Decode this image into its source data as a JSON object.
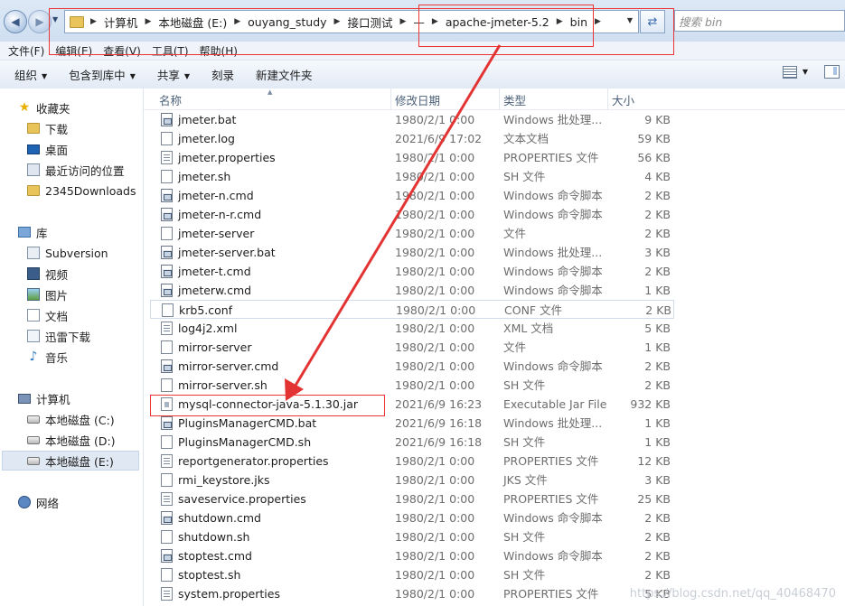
{
  "address": {
    "crumbs": [
      "计算机",
      "本地磁盘 (E:)",
      "ouyang_study",
      "接口测试",
      "—",
      "apache-jmeter-5.2",
      "bin"
    ],
    "search_placeholder": "搜索 bin"
  },
  "menu": [
    "文件(F)",
    "编辑(E)",
    "查看(V)",
    "工具(T)",
    "帮助(H)"
  ],
  "commands": [
    {
      "label": "组织",
      "dropdown": true
    },
    {
      "label": "包含到库中",
      "dropdown": true
    },
    {
      "label": "共享",
      "dropdown": true
    },
    {
      "label": "刻录",
      "dropdown": false
    },
    {
      "label": "新建文件夹",
      "dropdown": false
    }
  ],
  "nav": {
    "favorites": {
      "label": "收藏夹",
      "items": [
        "下载",
        "桌面",
        "最近访问的位置",
        "2345Downloads"
      ]
    },
    "libraries": {
      "label": "库",
      "items": [
        "Subversion",
        "视频",
        "图片",
        "文档",
        "迅雷下载",
        "音乐"
      ]
    },
    "computer": {
      "label": "计算机",
      "items": [
        "本地磁盘 (C:)",
        "本地磁盘 (D:)",
        "本地磁盘 (E:)"
      ]
    },
    "network": {
      "label": "网络"
    }
  },
  "columns": {
    "name": "名称",
    "date": "修改日期",
    "type": "类型",
    "size": "大小"
  },
  "files": [
    {
      "name": "jmeter.bat",
      "date": "1980/2/1 0:00",
      "type": "Windows 批处理...",
      "size": "9 KB",
      "icon": "bat"
    },
    {
      "name": "jmeter.log",
      "date": "2021/6/9 17:02",
      "type": "文本文档",
      "size": "59 KB",
      "icon": "txt"
    },
    {
      "name": "jmeter.properties",
      "date": "1980/2/1 0:00",
      "type": "PROPERTIES 文件",
      "size": "56 KB",
      "icon": "prop"
    },
    {
      "name": "jmeter.sh",
      "date": "1980/2/1 0:00",
      "type": "SH 文件",
      "size": "4 KB",
      "icon": "txt"
    },
    {
      "name": "jmeter-n.cmd",
      "date": "1980/2/1 0:00",
      "type": "Windows 命令脚本",
      "size": "2 KB",
      "icon": "cmd"
    },
    {
      "name": "jmeter-n-r.cmd",
      "date": "1980/2/1 0:00",
      "type": "Windows 命令脚本",
      "size": "2 KB",
      "icon": "cmd"
    },
    {
      "name": "jmeter-server",
      "date": "1980/2/1 0:00",
      "type": "文件",
      "size": "2 KB",
      "icon": "txt"
    },
    {
      "name": "jmeter-server.bat",
      "date": "1980/2/1 0:00",
      "type": "Windows 批处理...",
      "size": "3 KB",
      "icon": "bat"
    },
    {
      "name": "jmeter-t.cmd",
      "date": "1980/2/1 0:00",
      "type": "Windows 命令脚本",
      "size": "2 KB",
      "icon": "cmd"
    },
    {
      "name": "jmeterw.cmd",
      "date": "1980/2/1 0:00",
      "type": "Windows 命令脚本",
      "size": "1 KB",
      "icon": "cmd"
    },
    {
      "name": "krb5.conf",
      "date": "1980/2/1 0:00",
      "type": "CONF 文件",
      "size": "2 KB",
      "icon": "txt"
    },
    {
      "name": "log4j2.xml",
      "date": "1980/2/1 0:00",
      "type": "XML 文档",
      "size": "5 KB",
      "icon": "prop"
    },
    {
      "name": "mirror-server",
      "date": "1980/2/1 0:00",
      "type": "文件",
      "size": "1 KB",
      "icon": "txt"
    },
    {
      "name": "mirror-server.cmd",
      "date": "1980/2/1 0:00",
      "type": "Windows 命令脚本",
      "size": "2 KB",
      "icon": "cmd"
    },
    {
      "name": "mirror-server.sh",
      "date": "1980/2/1 0:00",
      "type": "SH 文件",
      "size": "2 KB",
      "icon": "txt"
    },
    {
      "name": "mysql-connector-java-5.1.30.jar",
      "date": "2021/6/9 16:23",
      "type": "Executable Jar File",
      "size": "932 KB",
      "icon": "jar"
    },
    {
      "name": "PluginsManagerCMD.bat",
      "date": "2021/6/9 16:18",
      "type": "Windows 批处理...",
      "size": "1 KB",
      "icon": "bat"
    },
    {
      "name": "PluginsManagerCMD.sh",
      "date": "2021/6/9 16:18",
      "type": "SH 文件",
      "size": "1 KB",
      "icon": "txt"
    },
    {
      "name": "reportgenerator.properties",
      "date": "1980/2/1 0:00",
      "type": "PROPERTIES 文件",
      "size": "12 KB",
      "icon": "prop"
    },
    {
      "name": "rmi_keystore.jks",
      "date": "1980/2/1 0:00",
      "type": "JKS 文件",
      "size": "3 KB",
      "icon": "txt"
    },
    {
      "name": "saveservice.properties",
      "date": "1980/2/1 0:00",
      "type": "PROPERTIES 文件",
      "size": "25 KB",
      "icon": "prop"
    },
    {
      "name": "shutdown.cmd",
      "date": "1980/2/1 0:00",
      "type": "Windows 命令脚本",
      "size": "2 KB",
      "icon": "cmd"
    },
    {
      "name": "shutdown.sh",
      "date": "1980/2/1 0:00",
      "type": "SH 文件",
      "size": "2 KB",
      "icon": "txt"
    },
    {
      "name": "stoptest.cmd",
      "date": "1980/2/1 0:00",
      "type": "Windows 命令脚本",
      "size": "2 KB",
      "icon": "cmd"
    },
    {
      "name": "stoptest.sh",
      "date": "1980/2/1 0:00",
      "type": "SH 文件",
      "size": "2 KB",
      "icon": "txt"
    },
    {
      "name": "system.properties",
      "date": "1980/2/1 0:00",
      "type": "PROPERTIES 文件",
      "size": "5 KB",
      "icon": "prop"
    }
  ],
  "watermark": "https://blog.csdn.net/qq_40468470",
  "colors": {
    "annotation": "#e33333",
    "selected_bg": "#e0e8f3"
  }
}
